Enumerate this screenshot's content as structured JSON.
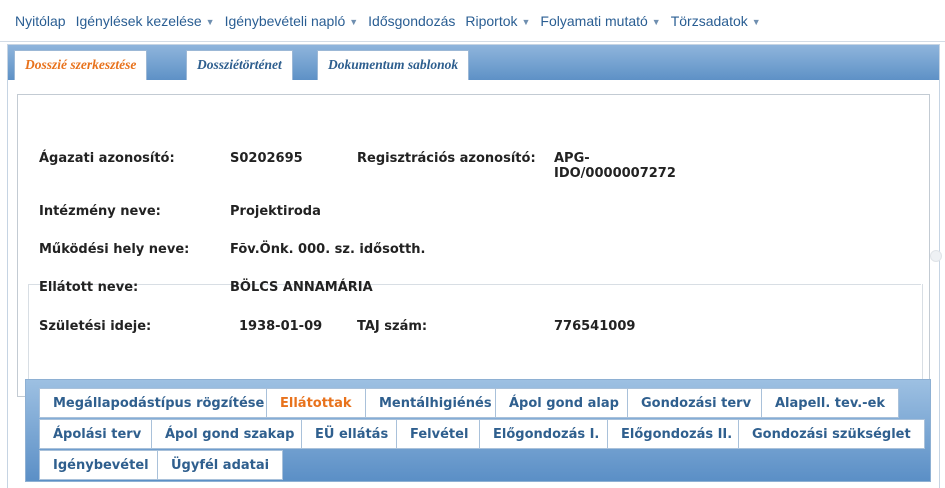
{
  "nav": {
    "items": [
      {
        "label": "Nyitólap",
        "dropdown": false
      },
      {
        "label": "Igénylések kezelése",
        "dropdown": true
      },
      {
        "label": "Igénybevételi napló",
        "dropdown": true
      },
      {
        "label": "Idősgondozás",
        "dropdown": false
      },
      {
        "label": "Riportok",
        "dropdown": true
      },
      {
        "label": "Folyamati mutató",
        "dropdown": true
      },
      {
        "label": "Törzsadatok",
        "dropdown": true
      }
    ]
  },
  "tabs": [
    {
      "label": "Dosszié szerkesztése",
      "active": true
    },
    {
      "label": "Dossziétörténet",
      "active": false
    },
    {
      "label": "Dokumentum sablonok",
      "active": false
    }
  ],
  "fields": {
    "agazati_label": "Ágazati azonosító:",
    "agazati_value": "S0202695",
    "regisztracios_label": "Regisztrációs azonosító:",
    "regisztracios_value_1": "APG-",
    "regisztracios_value_2": "IDO/0000007272",
    "intezmeny_label": "Intézmény neve:",
    "intezmeny_value": "Projektiroda",
    "mukodesi_label": "Működési hely neve:",
    "mukodesi_value": "Fõv.Önk. 000. sz. idősotth.",
    "ellatott_label": "Ellátott neve:",
    "ellatott_value": "BÖLCS ANNAMÁRIA",
    "szuletesi_label": "Születési ideje:",
    "szuletesi_value": "1938-01-09",
    "taj_label": "TAJ szám:",
    "taj_value": "776541009"
  },
  "subtabs": {
    "row1": [
      "Megállapodástípus rögzítése",
      "Ellátottak",
      "Mentálhigiénés",
      "Ápol gond alap",
      "Gondozási terv",
      "Alapell. tev.-ek"
    ],
    "row2": [
      "Ápolási terv",
      "Ápol gond szakap",
      "EÜ ellátás",
      "Felvétel",
      "Előgondozás I.",
      "Előgondozás II.",
      "Gondozási szükséglet"
    ],
    "row3": [
      "Igénybevétel",
      "Ügyfél adatai"
    ],
    "active": "Ellátottak"
  },
  "colors": {
    "accent": "#e8721c",
    "link": "#2a5e93",
    "tab_bar": "#5e91c6"
  }
}
